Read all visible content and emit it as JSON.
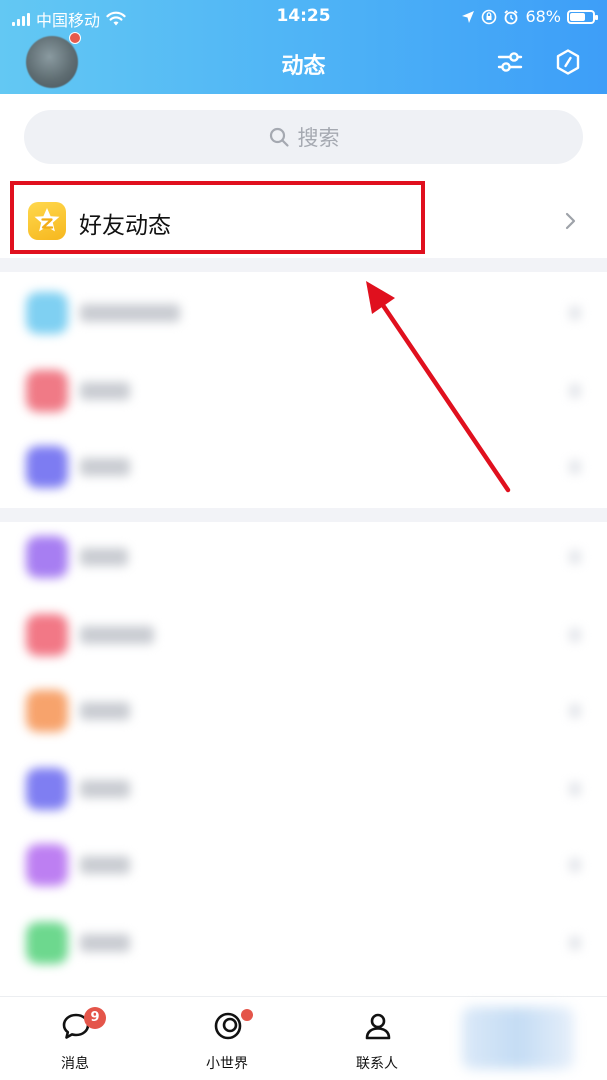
{
  "status_bar": {
    "carrier": "中国移动",
    "time": "14:25",
    "battery": "68%",
    "battery_level": 0.68
  },
  "header": {
    "title": "动态"
  },
  "search": {
    "placeholder": "搜索"
  },
  "friend_feed": {
    "label": "好友动态"
  },
  "blurred_items": {
    "group1_colors": [
      "#7fd0f2",
      "#f07a86",
      "#7d7cf2"
    ],
    "group2_colors": [
      "#a77ef2",
      "#f27886",
      "#f7a36c",
      "#7f7ef2",
      "#bd7ff2",
      "#6dd88e"
    ]
  },
  "annotation": {
    "box_color": "#e0101e",
    "arrow_color": "#e0101e"
  },
  "tabbar": {
    "tabs": [
      {
        "label": "消息",
        "badge": "9"
      },
      {
        "label": "小世界"
      },
      {
        "label": "联系人"
      }
    ]
  },
  "colors": {
    "header_gradient_start": "#63c8f3",
    "header_gradient_end": "#3d9ef8",
    "badge": "#e4554a",
    "qzone_icon": "#f6b71e"
  }
}
